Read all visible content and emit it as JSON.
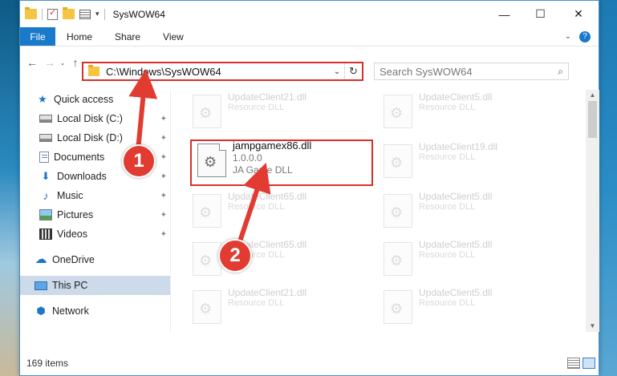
{
  "window": {
    "title": "SysWOW64",
    "controls": {
      "minimize": "—",
      "maximize": "☐",
      "close": "✕"
    }
  },
  "ribbon": {
    "tabs": [
      "File",
      "Home",
      "Share",
      "View"
    ],
    "expand": "⌄",
    "help": "?"
  },
  "nav": {
    "back": "←",
    "forward": "→",
    "recent": "⌄",
    "up": "↑",
    "address": "C:\\Windows\\SysWOW64",
    "address_dropdown": "⌄",
    "refresh": "↻",
    "search_placeholder": "Search SysWOW64",
    "search_icon": "⌕"
  },
  "sidebar": {
    "items": [
      {
        "label": "Quick access",
        "icon": "star-icon",
        "glyph": "★"
      },
      {
        "label": "Local Disk (C:)",
        "icon": "disk-icon",
        "pinned": true
      },
      {
        "label": "Local Disk (D:)",
        "icon": "disk-icon",
        "pinned": true
      },
      {
        "label": "Documents",
        "icon": "document-icon",
        "pinned": true
      },
      {
        "label": "Downloads",
        "icon": "download-icon",
        "glyph": "⬇",
        "pinned": true
      },
      {
        "label": "Music",
        "icon": "music-icon",
        "glyph": "♪",
        "pinned": true
      },
      {
        "label": "Pictures",
        "icon": "picture-icon",
        "pinned": true
      },
      {
        "label": "Videos",
        "icon": "video-icon",
        "pinned": true
      },
      {
        "label": "OneDrive",
        "icon": "cloud-icon",
        "glyph": "☁"
      },
      {
        "label": "This PC",
        "icon": "computer-icon",
        "selected": true
      },
      {
        "label": "Network",
        "icon": "network-icon",
        "glyph": "⬢"
      }
    ],
    "pin_glyph": "📌"
  },
  "files": {
    "faded": [
      {
        "name": "UpdateClient21.dll",
        "desc": "Resource DLL"
      },
      {
        "name": "UpdateClient5.dll",
        "desc": "Resource DLL"
      },
      {
        "name": "UpdateClient19.dll",
        "desc": "Resource DLL"
      },
      {
        "name": "UpdateClient65.dll",
        "desc": "Resource DLL"
      },
      {
        "name": "UpdateClient5.dll",
        "desc": "Resource DLL"
      },
      {
        "name": "UpdateClient65.dll",
        "desc": "Resource DLL"
      },
      {
        "name": "UpdateClient5.dll",
        "desc": "Resource DLL"
      },
      {
        "name": "UpdateClient21.dll",
        "desc": "Resource DLL"
      },
      {
        "name": "UpdateClient5.dll",
        "desc": "Resource DLL"
      }
    ],
    "highlighted": {
      "name": "jampgamex86.dll",
      "version": "1.0.0.0",
      "desc": "JA Game DLL"
    }
  },
  "status": {
    "item_count": "169 items"
  },
  "annotations": {
    "step1": "1",
    "step2": "2",
    "color": "#e23b32"
  }
}
